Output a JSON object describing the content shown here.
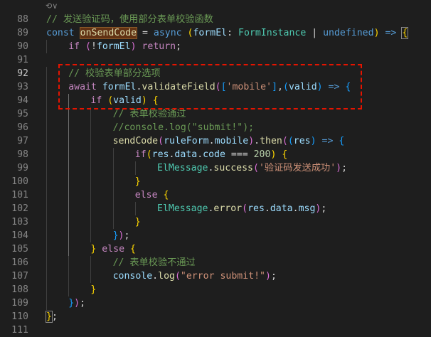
{
  "editor": {
    "fold_hint": "⟲∨",
    "lines": [
      {
        "n": "88",
        "segs": [
          [
            "cmt",
            "// 发送验证码，使用部分表单校验函数"
          ]
        ]
      },
      {
        "n": "89",
        "segs": [
          [
            "kw",
            "const "
          ],
          [
            "fnhl",
            "onSendCode"
          ],
          [
            "",
            " = "
          ],
          [
            "kw",
            "async "
          ],
          [
            "b1",
            "("
          ],
          [
            "var",
            "formEl"
          ],
          [
            "",
            ": "
          ],
          [
            "type",
            "FormInstance"
          ],
          [
            "",
            " | "
          ],
          [
            "kw",
            "undefined"
          ],
          [
            "b1",
            ")"
          ],
          [
            "",
            " "
          ],
          [
            "kw",
            "=>"
          ],
          [
            "",
            " "
          ],
          [
            "b1m",
            "{"
          ]
        ]
      },
      {
        "n": "90",
        "segs": [
          [
            "ctl",
            "if "
          ],
          [
            "b2",
            "("
          ],
          [
            "",
            "!"
          ],
          [
            "var",
            "formEl"
          ],
          [
            "b2",
            ")"
          ],
          [
            "",
            " "
          ],
          [
            "ctl",
            "return"
          ],
          [
            "",
            ";"
          ]
        ]
      },
      {
        "n": "91",
        "segs": []
      },
      {
        "n": "92",
        "segs": [
          [
            "cmt",
            "// 校验表单部分选项"
          ]
        ]
      },
      {
        "n": "93",
        "segs": [
          [
            "ctl",
            "await "
          ],
          [
            "var",
            "formEl"
          ],
          [
            "",
            "."
          ],
          [
            "fn",
            "validateField"
          ],
          [
            "b2",
            "("
          ],
          [
            "b3",
            "["
          ],
          [
            "str",
            "'mobile'"
          ],
          [
            "b3",
            "]"
          ],
          [
            "",
            ","
          ],
          [
            "b3",
            "("
          ],
          [
            "var",
            "valid"
          ],
          [
            "b3",
            ")"
          ],
          [
            "",
            " "
          ],
          [
            "kw",
            "=>"
          ],
          [
            "",
            " "
          ],
          [
            "b3",
            "{"
          ]
        ]
      },
      {
        "n": "94",
        "segs": [
          [
            "ctl",
            "if "
          ],
          [
            "b1",
            "("
          ],
          [
            "var",
            "valid"
          ],
          [
            "b1",
            ")"
          ],
          [
            "",
            " "
          ],
          [
            "b1",
            "{"
          ]
        ]
      },
      {
        "n": "95",
        "segs": [
          [
            "cmt",
            "// 表单校验通过"
          ]
        ]
      },
      {
        "n": "96",
        "segs": [
          [
            "cmt",
            "//console.log(\"submit!\");"
          ]
        ]
      },
      {
        "n": "97",
        "segs": [
          [
            "fn",
            "sendCode"
          ],
          [
            "b2",
            "("
          ],
          [
            "var",
            "ruleForm"
          ],
          [
            "",
            "."
          ],
          [
            "var",
            "mobile"
          ],
          [
            "b2",
            ")"
          ],
          [
            "",
            "."
          ],
          [
            "fn",
            "then"
          ],
          [
            "b2",
            "("
          ],
          [
            "b3",
            "("
          ],
          [
            "var",
            "res"
          ],
          [
            "b3",
            ")"
          ],
          [
            "",
            " "
          ],
          [
            "kw",
            "=>"
          ],
          [
            "",
            " "
          ],
          [
            "b3",
            "{"
          ]
        ]
      },
      {
        "n": "98",
        "segs": [
          [
            "ctl",
            "if"
          ],
          [
            "b1",
            "("
          ],
          [
            "var",
            "res"
          ],
          [
            "",
            "."
          ],
          [
            "var",
            "data"
          ],
          [
            "",
            "."
          ],
          [
            "var",
            "code"
          ],
          [
            "",
            " === "
          ],
          [
            "num",
            "200"
          ],
          [
            "b1",
            ")"
          ],
          [
            "",
            " "
          ],
          [
            "b1",
            "{"
          ]
        ]
      },
      {
        "n": "99",
        "segs": [
          [
            "type",
            "ElMessage"
          ],
          [
            "",
            "."
          ],
          [
            "fn",
            "success"
          ],
          [
            "b2",
            "("
          ],
          [
            "str",
            "'验证码发送成功'"
          ],
          [
            "b2",
            ")"
          ],
          [
            "",
            ";"
          ]
        ]
      },
      {
        "n": "100",
        "segs": [
          [
            "b1",
            "}"
          ]
        ]
      },
      {
        "n": "101",
        "segs": [
          [
            "ctl",
            "else "
          ],
          [
            "b1",
            "{"
          ]
        ]
      },
      {
        "n": "102",
        "segs": [
          [
            "type",
            "ElMessage"
          ],
          [
            "",
            "."
          ],
          [
            "fn",
            "error"
          ],
          [
            "b2",
            "("
          ],
          [
            "var",
            "res"
          ],
          [
            "",
            "."
          ],
          [
            "var",
            "data"
          ],
          [
            "",
            "."
          ],
          [
            "var",
            "msg"
          ],
          [
            "b2",
            ")"
          ],
          [
            "",
            ";"
          ]
        ]
      },
      {
        "n": "103",
        "segs": [
          [
            "b1",
            "}"
          ]
        ]
      },
      {
        "n": "104",
        "segs": [
          [
            "b3",
            "}"
          ],
          [
            "b2",
            ")"
          ],
          [
            "",
            ";"
          ]
        ]
      },
      {
        "n": "105",
        "segs": [
          [
            "b1",
            "}"
          ],
          [
            "",
            " "
          ],
          [
            "ctl",
            "else "
          ],
          [
            "b1",
            "{"
          ]
        ]
      },
      {
        "n": "106",
        "segs": [
          [
            "cmt",
            "// 表单校验不通过"
          ]
        ]
      },
      {
        "n": "107",
        "segs": [
          [
            "var",
            "console"
          ],
          [
            "",
            "."
          ],
          [
            "fn",
            "log"
          ],
          [
            "b2",
            "("
          ],
          [
            "str",
            "\"error submit!\""
          ],
          [
            "b2",
            ")"
          ],
          [
            "",
            ";"
          ]
        ]
      },
      {
        "n": "108",
        "segs": [
          [
            "b1",
            "}"
          ]
        ]
      },
      {
        "n": "109",
        "segs": [
          [
            "b3",
            "}"
          ],
          [
            "b2",
            ")"
          ],
          [
            "",
            ";"
          ]
        ]
      },
      {
        "n": "110",
        "segs": [
          [
            "b1m",
            "}"
          ],
          [
            "",
            ";"
          ]
        ]
      },
      {
        "n": "111",
        "segs": []
      }
    ]
  }
}
